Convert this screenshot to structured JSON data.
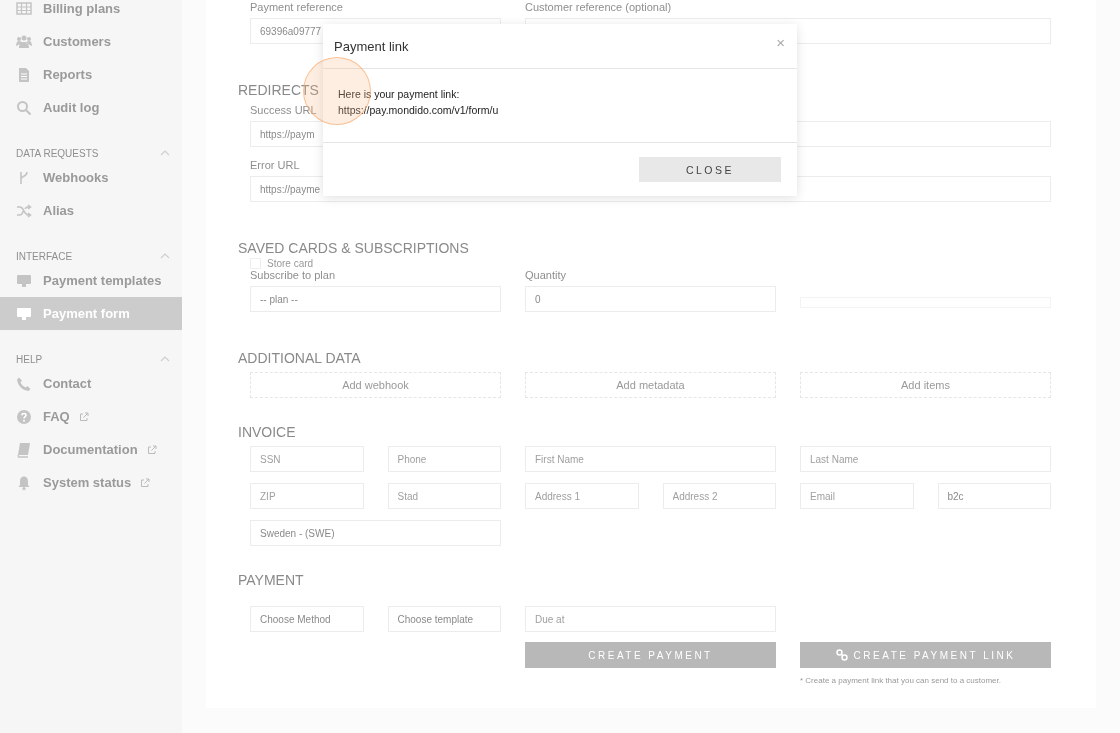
{
  "sidebar": {
    "sections": [
      {
        "items": [
          {
            "label": "Billing plans",
            "selected": false,
            "external": false
          },
          {
            "label": "Customers",
            "selected": false,
            "external": false
          },
          {
            "label": "Reports",
            "selected": false,
            "external": false
          },
          {
            "label": "Audit log",
            "selected": false,
            "external": false
          }
        ]
      },
      {
        "title": "DATA REQUESTS",
        "expanded": true,
        "items": [
          {
            "label": "Webhooks",
            "selected": false,
            "external": false
          },
          {
            "label": "Alias",
            "selected": false,
            "external": false
          }
        ]
      },
      {
        "title": "INTERFACE",
        "expanded": true,
        "items": [
          {
            "label": "Payment templates",
            "selected": false,
            "external": false
          },
          {
            "label": "Payment form",
            "selected": true,
            "external": false
          }
        ]
      },
      {
        "title": "HELP",
        "expanded": true,
        "items": [
          {
            "label": "Contact",
            "selected": false,
            "external": false
          },
          {
            "label": "FAQ",
            "selected": false,
            "external": true
          },
          {
            "label": "Documentation",
            "selected": false,
            "external": true
          },
          {
            "label": "System status",
            "selected": false,
            "external": true
          }
        ]
      }
    ]
  },
  "form": {
    "references": [
      {
        "label": "Payment reference",
        "value": "69396a09777"
      },
      {
        "label": "Customer reference (optional)"
      }
    ],
    "redirects": {
      "title": "REDIRECTS",
      "fields": [
        {
          "label": "Success URL",
          "value": "https://paym"
        },
        {
          "label": "Error URL",
          "value": "https://payme"
        }
      ]
    },
    "saved_cards": {
      "title": "SAVED CARDS & SUBSCRIPTIONS",
      "store_card": {
        "label": "Store card",
        "checked": false
      },
      "plan": {
        "label": "Subscribe to plan",
        "value": "-- plan --"
      },
      "quantity": {
        "label": "Quantity",
        "value": "0"
      }
    },
    "additional_data": {
      "title": "ADDITIONAL DATA",
      "buttons": [
        "Add webhook",
        "Add metadata",
        "Add items"
      ]
    },
    "invoice": {
      "title": "INVOICE",
      "fields": [
        {
          "placeholder": "SSN"
        },
        {
          "placeholder": "Phone"
        },
        {
          "placeholder": "First Name"
        },
        {
          "placeholder": "Last Name"
        },
        {
          "placeholder": "ZIP"
        },
        {
          "placeholder": "Stad"
        },
        {
          "placeholder": "Address 1"
        },
        {
          "placeholder": "Address 2"
        },
        {
          "placeholder": "Email"
        },
        {
          "value": "b2c"
        },
        {
          "value": "Sweden - (SWE)"
        }
      ]
    },
    "payment": {
      "title": "PAYMENT",
      "fields": [
        {
          "value": "Choose Method"
        },
        {
          "value": "Choose template"
        },
        {
          "placeholder": "Due at"
        }
      ],
      "buttons": [
        {
          "label": "CREATE PAYMENT",
          "kind": "plain"
        },
        {
          "label": "CREATE PAYMENT LINK",
          "kind": "link"
        }
      ],
      "note": "* Create a payment link that you can send to a customer."
    }
  },
  "modal": {
    "title": "Payment link",
    "close": "×",
    "lines": [
      "Here is your payment link:",
      "https://pay.mondido.com/v1/form/u"
    ],
    "button": "CLOSE"
  }
}
